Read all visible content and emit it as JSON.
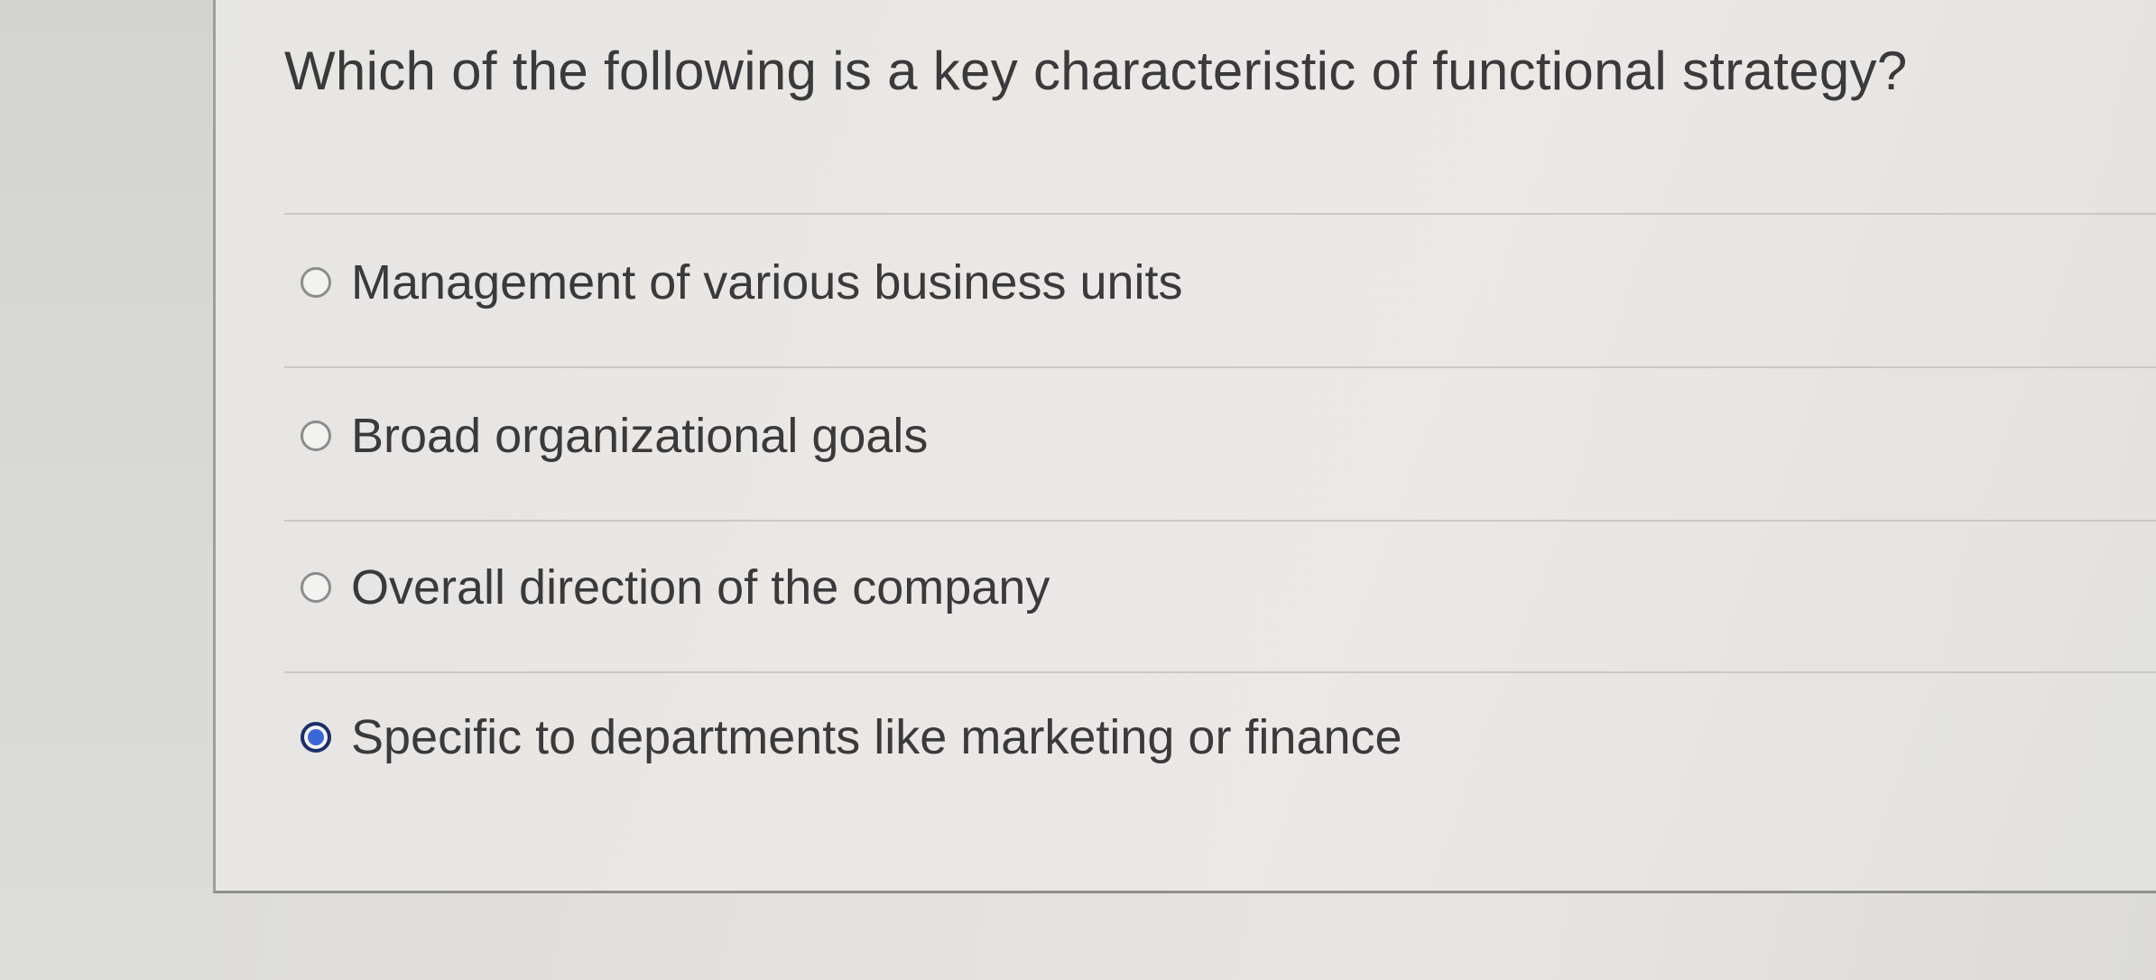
{
  "question": {
    "text": "Which of the following is a key characteristic of functional strategy?"
  },
  "options": [
    {
      "label": "Management of various business units",
      "selected": false
    },
    {
      "label": "Broad organizational goals",
      "selected": false
    },
    {
      "label": "Overall direction of the company",
      "selected": false
    },
    {
      "label": "Specific to departments like marketing or finance",
      "selected": true
    }
  ],
  "colors": {
    "radio_selected_fill": "#3a67d6",
    "radio_selected_ring": "#1b2f6b",
    "text": "#3a3a3c"
  }
}
